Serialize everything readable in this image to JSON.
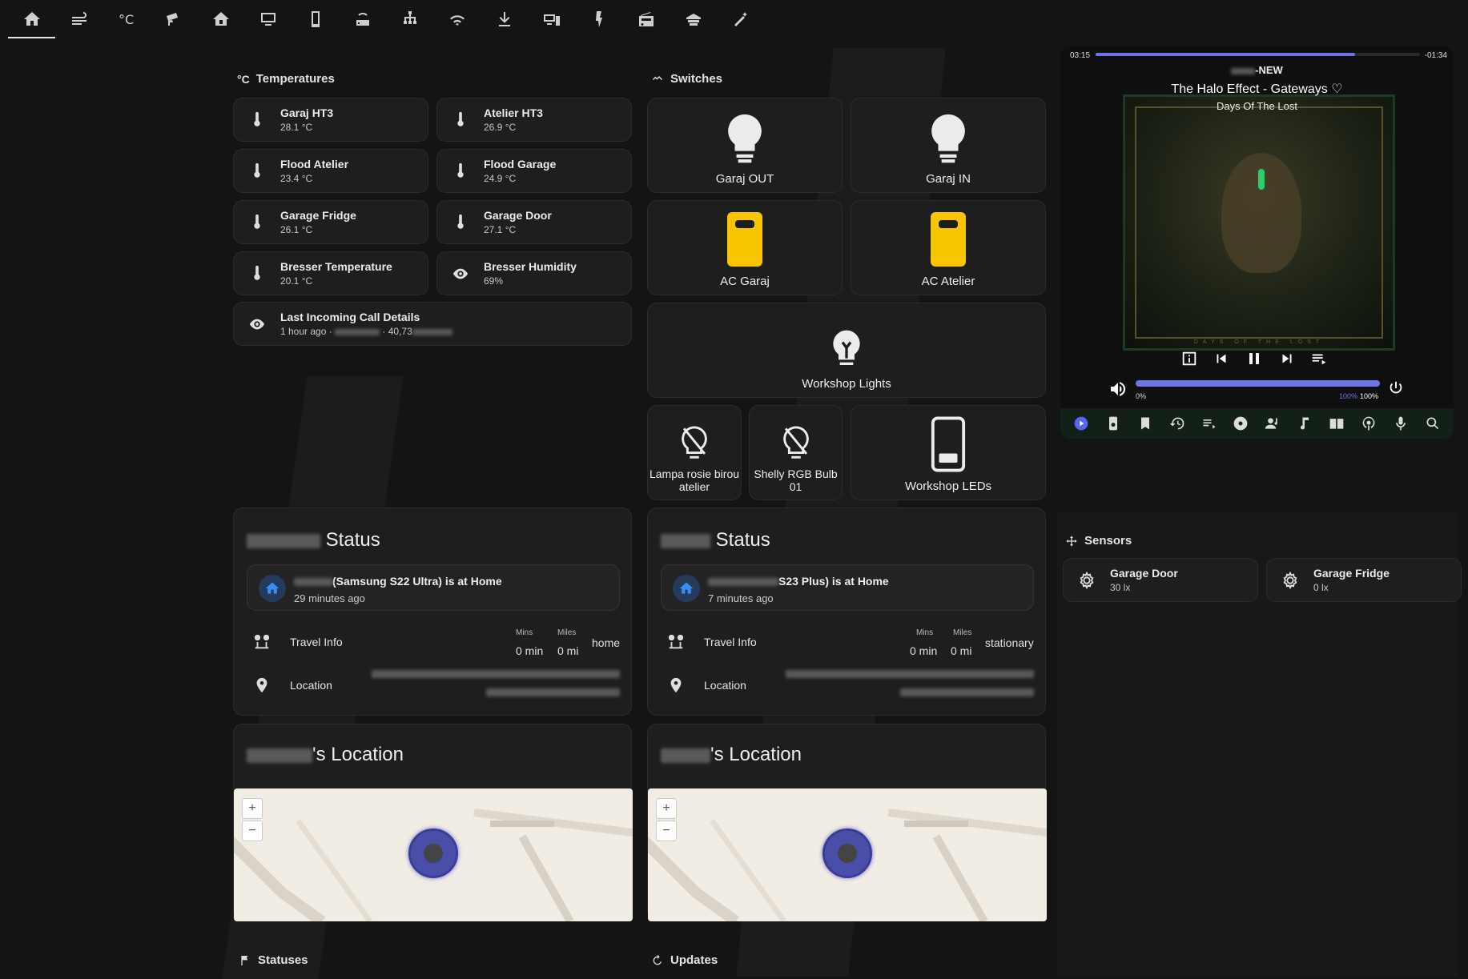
{
  "nav": {
    "tabs": [
      {
        "icon": "home-icon"
      },
      {
        "icon": "weather-icon"
      },
      {
        "icon": "temperature-icon"
      },
      {
        "icon": "cctv-icon"
      },
      {
        "icon": "home-outline-icon"
      },
      {
        "icon": "monitor-icon"
      },
      {
        "icon": "phone-icon"
      },
      {
        "icon": "router-icon"
      },
      {
        "icon": "network-icon"
      },
      {
        "icon": "wifi-icon"
      },
      {
        "icon": "download-icon"
      },
      {
        "icon": "devices-icon"
      },
      {
        "icon": "vacuum-icon"
      },
      {
        "icon": "radio-icon"
      },
      {
        "icon": "garage-icon"
      },
      {
        "icon": "magic-wand-icon"
      }
    ]
  },
  "temperatures": {
    "title": "Temperatures",
    "unit_icon": "°C",
    "items": [
      {
        "name": "Garaj HT3",
        "state": "28.1 °C"
      },
      {
        "name": "Atelier HT3",
        "state": "26.9 °C"
      },
      {
        "name": "Flood Atelier",
        "state": "23.4 °C"
      },
      {
        "name": "Flood Garage",
        "state": "24.9 °C"
      },
      {
        "name": "Garage Fridge",
        "state": "26.1 °C"
      },
      {
        "name": "Garage Door",
        "state": "27.1 °C"
      },
      {
        "name": "Bresser Temperature",
        "state": "20.1 °C"
      },
      {
        "name": "Bresser Humidity",
        "state": "69%"
      }
    ],
    "last_call": {
      "name": "Last Incoming Call Details",
      "time": "1 hour ago ·",
      "number": "40,73"
    }
  },
  "switches": {
    "title": "Switches",
    "items": [
      {
        "name": "Garaj OUT"
      },
      {
        "name": "Garaj IN"
      },
      {
        "name": "AC Garaj"
      },
      {
        "name": "AC Atelier"
      },
      {
        "name": "Workshop Lights"
      },
      {
        "name": "Lampa rosie birou atelier"
      },
      {
        "name": "Shelly RGB Bulb 01"
      },
      {
        "name": "Workshop LEDs"
      }
    ]
  },
  "person1": {
    "status_title": "Status",
    "device": "(Samsung S22 Ultra) is at Home",
    "ago": "29 minutes ago",
    "travel_label": "Travel Info",
    "mins_label": "Mins",
    "miles_label": "Miles",
    "mins": "0 min",
    "miles": "0 mi",
    "travel_state": "home",
    "location_label": "Location",
    "location_title": "'s Location"
  },
  "person2": {
    "status_title": "Status",
    "device": "S23 Plus) is at Home",
    "ago": "7 minutes ago",
    "travel_label": "Travel Info",
    "mins_label": "Mins",
    "miles_label": "Miles",
    "mins": "0 min",
    "miles": "0 mi",
    "travel_state": "stationary",
    "location_label": "Location",
    "location_title": "'s Location"
  },
  "player": {
    "elapsed": "03:15",
    "remaining": "-01:34",
    "progress": 0.8,
    "source": "-NEW",
    "title": "The Halo Effect - Gateways",
    "album": "Days Of The Lost",
    "art_caption": "DAYS OF THE LOST",
    "vol_min": "0%",
    "vol_max_a": "100%",
    "vol_max_b": "100%",
    "volume": 1.0
  },
  "sensors": {
    "title": "Sensors",
    "items": [
      {
        "name": "Garage Door",
        "state": "30 lx"
      },
      {
        "name": "Garage Fridge",
        "state": "0 lx"
      }
    ]
  },
  "bottom": {
    "statuses": "Statuses",
    "updates": "Updates"
  },
  "colors": {
    "accent": "#5865f2",
    "ac_yellow": "#f7c600",
    "bg": "#141414",
    "card": "#1e1e1e"
  }
}
